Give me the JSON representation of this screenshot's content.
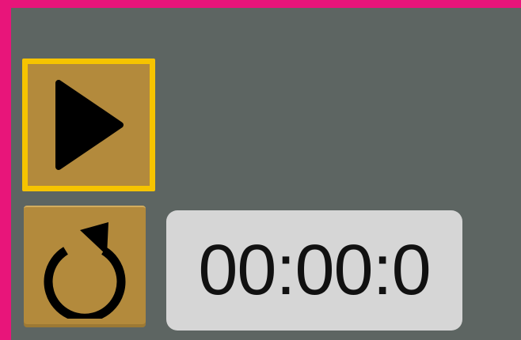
{
  "timer": {
    "display": "00:00:0"
  },
  "icons": {
    "play": "play-icon",
    "reset": "reset-icon"
  },
  "colors": {
    "page_border": "#e8157a",
    "panel_bg": "#5d6562",
    "button_bg": "#b38a3c",
    "focus_outline": "#f6c400",
    "timer_bg": "#d6d6d6"
  }
}
